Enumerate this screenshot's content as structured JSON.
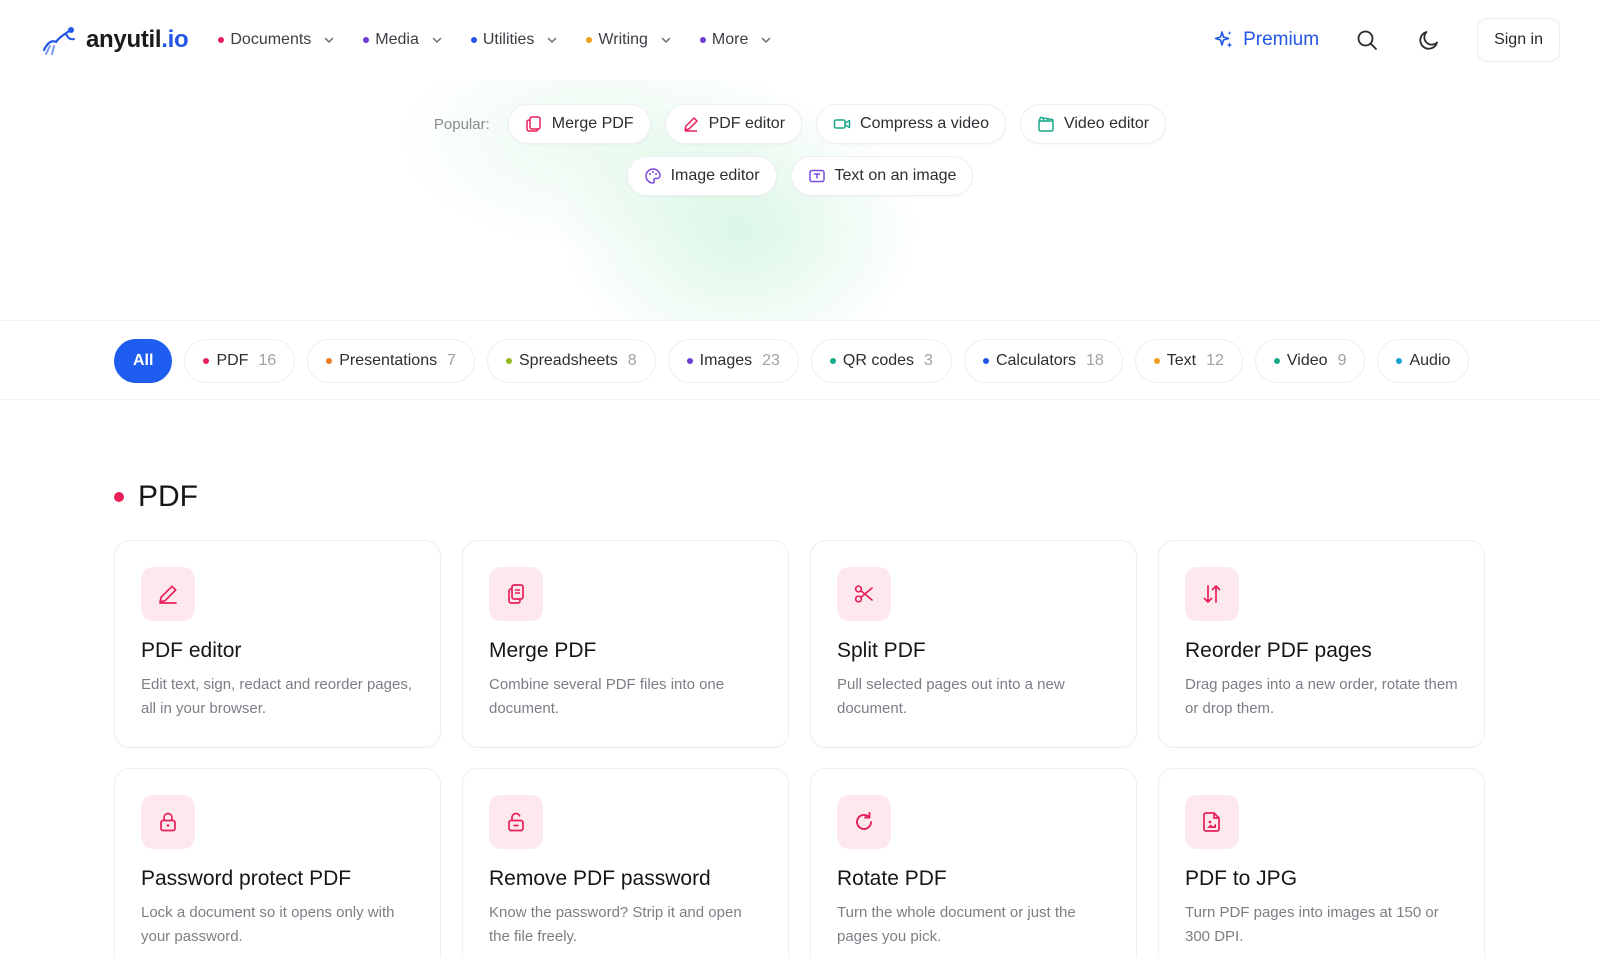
{
  "brand": {
    "name": "anyutil",
    "tld": ".io"
  },
  "nav": [
    {
      "label": "Documents",
      "dot": "#e8205a"
    },
    {
      "label": "Media",
      "dot": "#6a3fd8"
    },
    {
      "label": "Utilities",
      "dot": "#2456e6"
    },
    {
      "label": "Writing",
      "dot": "#f0a020"
    },
    {
      "label": "More",
      "dot": "#6a3fd8"
    }
  ],
  "header": {
    "premium_label": "Premium",
    "signin_label": "Sign in"
  },
  "popular": {
    "label": "Popular:",
    "items": [
      {
        "label": "Merge PDF",
        "icon": "merge-icon",
        "color": "#e8205a"
      },
      {
        "label": "PDF editor",
        "icon": "pen-icon",
        "color": "#e8205a"
      },
      {
        "label": "Compress a video",
        "icon": "video-camera-icon",
        "color": "#1aa88a"
      },
      {
        "label": "Video editor",
        "icon": "clapperboard-icon",
        "color": "#1aa88a"
      },
      {
        "label": "Image editor",
        "icon": "palette-icon",
        "color": "#7a4ae0"
      },
      {
        "label": "Text on an image",
        "icon": "text-image-icon",
        "color": "#7a4ae0"
      }
    ]
  },
  "categories": [
    {
      "label": "All",
      "count": "",
      "dot": ""
    },
    {
      "label": "PDF",
      "count": "16",
      "dot": "#e8205a"
    },
    {
      "label": "Presentations",
      "count": "7",
      "dot": "#f07a20"
    },
    {
      "label": "Spreadsheets",
      "count": "8",
      "dot": "#90b820"
    },
    {
      "label": "Images",
      "count": "23",
      "dot": "#6a3fd8"
    },
    {
      "label": "QR codes",
      "count": "3",
      "dot": "#1aa88a"
    },
    {
      "label": "Calculators",
      "count": "18",
      "dot": "#2456e6"
    },
    {
      "label": "Text",
      "count": "12",
      "dot": "#f0a020"
    },
    {
      "label": "Video",
      "count": "9",
      "dot": "#1aa88a"
    },
    {
      "label": "Audio",
      "count": "",
      "dot": "#1aa0d8"
    }
  ],
  "section": {
    "title": "PDF",
    "color": "#e8205a"
  },
  "tools": [
    {
      "title": "PDF editor",
      "desc": "Edit text, sign, redact and reorder pages, all in your browser.",
      "icon": "pen-icon"
    },
    {
      "title": "Merge PDF",
      "desc": "Combine several PDF files into one document.",
      "icon": "merge-icon"
    },
    {
      "title": "Split PDF",
      "desc": "Pull selected pages out into a new document.",
      "icon": "scissors-icon"
    },
    {
      "title": "Reorder PDF pages",
      "desc": "Drag pages into a new order, rotate them or drop them.",
      "icon": "reorder-arrows-icon"
    },
    {
      "title": "Password protect PDF",
      "desc": "Lock a document so it opens only with your password.",
      "icon": "lock-icon"
    },
    {
      "title": "Remove PDF password",
      "desc": "Know the password? Strip it and open the file freely.",
      "icon": "unlock-icon"
    },
    {
      "title": "Rotate PDF",
      "desc": "Turn the whole document or just the pages you pick.",
      "icon": "rotate-icon"
    },
    {
      "title": "PDF to JPG",
      "desc": "Turn PDF pages into images at 150 or 300 DPI.",
      "icon": "file-image-icon"
    }
  ]
}
